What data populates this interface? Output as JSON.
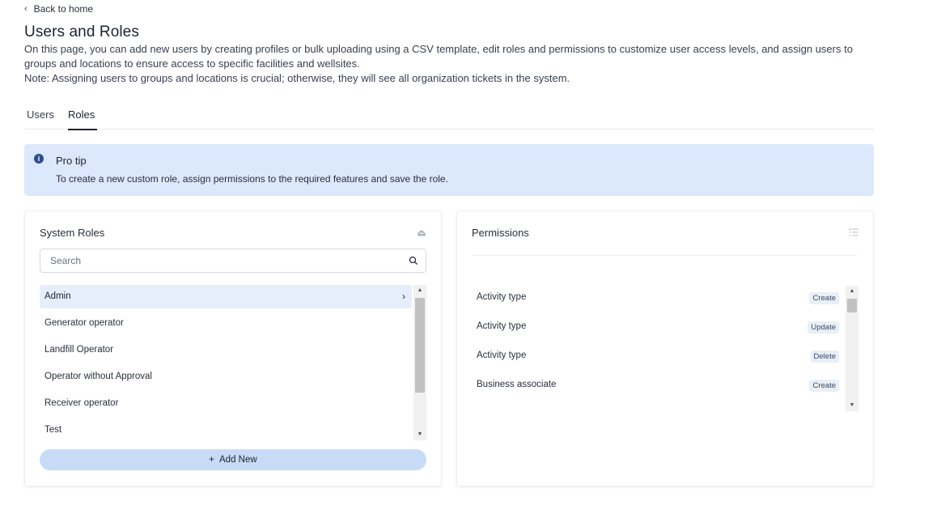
{
  "nav": {
    "back_label": "Back to home"
  },
  "page": {
    "title": "Users and Roles",
    "description_line1": "On this page, you can add new users by creating profiles or bulk uploading using a CSV template, edit roles and permissions to customize user access levels, and assign users to groups and locations to ensure access to specific facilities and wellsites.",
    "description_note": "Note: Assigning users to groups and locations is crucial; otherwise, they will see all organization tickets in the system."
  },
  "tabs": [
    {
      "label": "Users",
      "active": false
    },
    {
      "label": "Roles",
      "active": true
    }
  ],
  "tip": {
    "title": "Pro tip",
    "text": "To create a new custom role, assign permissions to the required features and save the role."
  },
  "system_roles": {
    "title": "System Roles",
    "search_placeholder": "Search",
    "search_value": "",
    "items": [
      {
        "label": "Admin",
        "selected": true
      },
      {
        "label": "Generator operator",
        "selected": false
      },
      {
        "label": "Landfill Operator",
        "selected": false
      },
      {
        "label": "Operator without Approval",
        "selected": false
      },
      {
        "label": "Receiver operator",
        "selected": false
      },
      {
        "label": "Test",
        "selected": false
      }
    ],
    "add_new_label": "Add New"
  },
  "permissions": {
    "title": "Permissions",
    "items": [
      {
        "feature": "Activity type",
        "action": "Create"
      },
      {
        "feature": "Activity type",
        "action": "Update"
      },
      {
        "feature": "Activity type",
        "action": "Delete"
      },
      {
        "feature": "Business associate",
        "action": "Create"
      }
    ]
  },
  "colors": {
    "accent": "#2c4f8f",
    "tip_background": "#dce8fb",
    "selected_row": "#e6eefc",
    "add_button": "#c7dbf7"
  }
}
